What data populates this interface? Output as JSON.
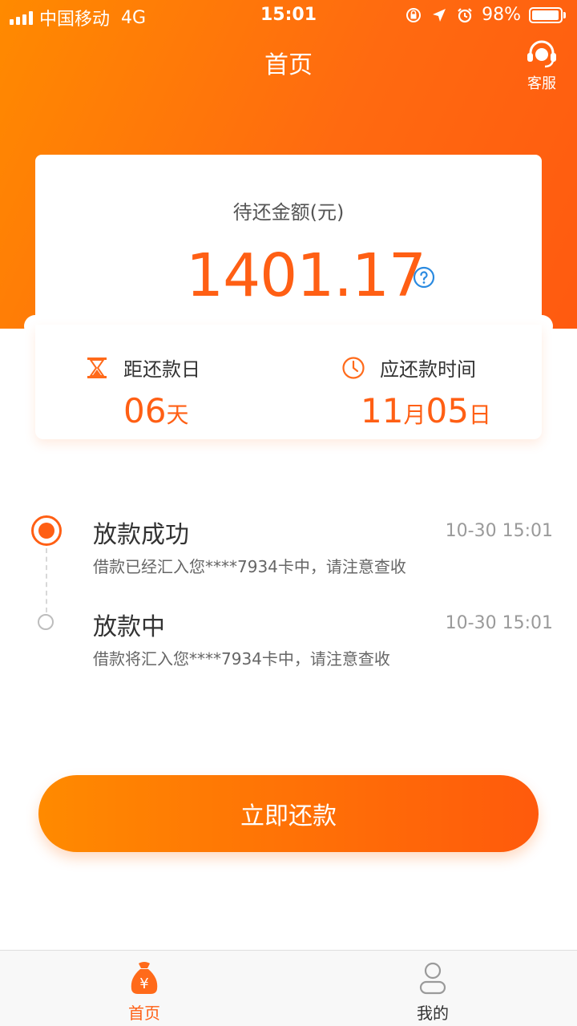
{
  "status_bar": {
    "carrier": "中国移动",
    "network": "4G",
    "time": "15:01",
    "battery": "98%",
    "battery_level": 0.98
  },
  "nav": {
    "title": "首页",
    "service_label": "客服"
  },
  "summary": {
    "amount_label": "待还金额(元)",
    "amount": "1401.17",
    "days_label": "距还款日",
    "days_value": "06",
    "days_unit": "天",
    "due_label": "应还款时间",
    "due_month": "11",
    "due_month_unit": "月",
    "due_day": "05",
    "due_day_unit": "日"
  },
  "timeline": [
    {
      "title": "放款成功",
      "time": "10-30 15:01",
      "desc": "借款已经汇入您****7934卡中，请注意查收",
      "active": true
    },
    {
      "title": "放款中",
      "time": "10-30 15:01",
      "desc": "借款将汇入您****7934卡中，请注意查收",
      "active": false
    }
  ],
  "action": {
    "pay_label": "立即还款"
  },
  "tabs": [
    {
      "label": "首页",
      "icon": "money-bag-icon",
      "active": true
    },
    {
      "label": "我的",
      "icon": "user-icon",
      "active": false
    }
  ],
  "colors": {
    "accent": "#ff5f14",
    "gradient_start": "#ff8a00",
    "gradient_end": "#ff5a0c",
    "help_icon": "#2a8ae0"
  }
}
